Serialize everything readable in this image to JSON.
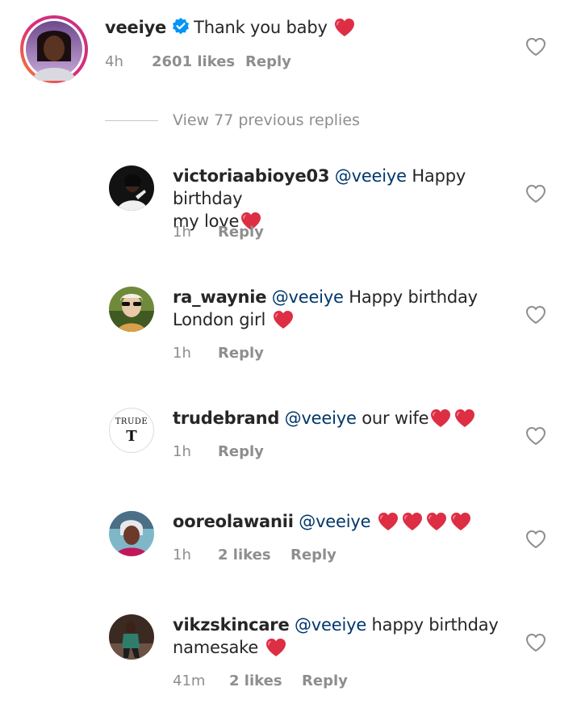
{
  "parent_comment": {
    "username": "veeiye",
    "verified": true,
    "text": "Thank you baby",
    "time": "4h",
    "likes": "2601 likes",
    "reply_label": "Reply",
    "emoji": "red-heart"
  },
  "view_replies": {
    "label": "View 77 previous replies"
  },
  "replies": [
    {
      "username": "victoriaabioye03",
      "mention": "@veeiye",
      "text_line1": "Happy birthday",
      "text_line2": "my love",
      "time": "1h",
      "reply_label": "Reply"
    },
    {
      "username": "ra_waynie",
      "mention": "@veeiye",
      "text_line1": "Happy birthday",
      "text_line2": "London girl",
      "time": "1h",
      "reply_label": "Reply"
    },
    {
      "username": "trudebrand",
      "mention": "@veeiye",
      "text_line1": "our wife",
      "time": "1h",
      "reply_label": "Reply",
      "avatar_text": "TRUDE",
      "avatar_glyph": "T"
    },
    {
      "username": "ooreolawanii",
      "mention": "@veeiye",
      "time": "1h",
      "likes": "2 likes",
      "reply_label": "Reply"
    },
    {
      "username": "vikzskincare",
      "mention": "@veeiye",
      "text_line1": "happy birthday",
      "text_line2": "namesake",
      "time": "41m",
      "likes": "2 likes",
      "reply_label": "Reply"
    }
  ],
  "colors": {
    "text": "#262626",
    "meta": "#8e8e8e",
    "mention": "#00376b",
    "verified": "#0095f6",
    "heart": "#e0245e",
    "story_ring_start": "#f58529",
    "story_ring_end": "#dd2a7b"
  },
  "icons": {
    "like": "heart-outline-icon",
    "verified": "verified-badge-icon",
    "emoji": "red-heart-emoji"
  }
}
